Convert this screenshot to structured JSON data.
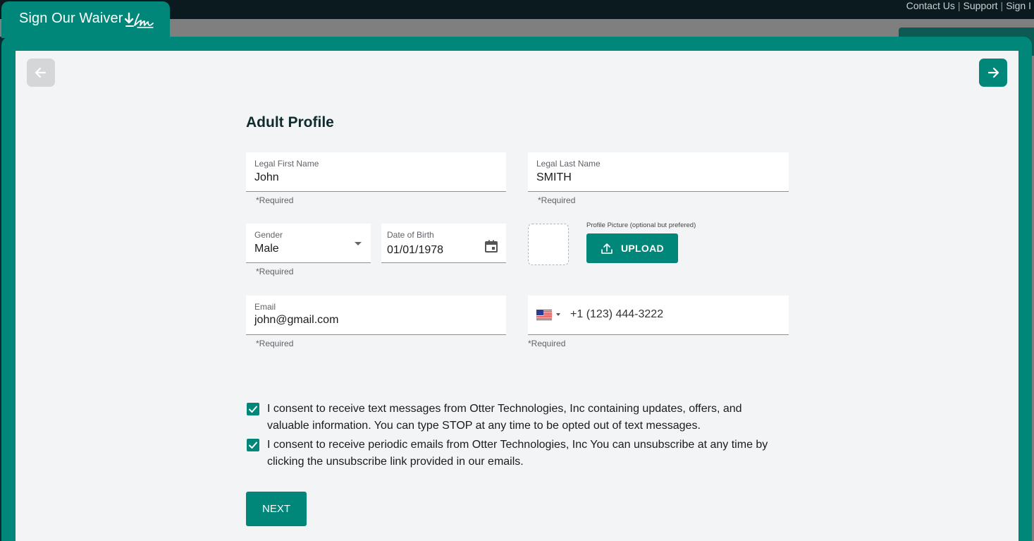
{
  "top_links": [
    "Contact Us",
    "Support",
    "Sign I"
  ],
  "tab": {
    "label": "Sign Our Waiver"
  },
  "form": {
    "title": "Adult Profile",
    "first_name": {
      "label": "Legal First Name",
      "value": "John",
      "helper": "*Required"
    },
    "last_name": {
      "label": "Legal Last Name",
      "value": "SMITH",
      "helper": "*Required"
    },
    "gender": {
      "label": "Gender",
      "value": "Male",
      "helper": "*Required"
    },
    "dob": {
      "label": "Date of Birth",
      "value": "01/01/1978"
    },
    "picture": {
      "label": "Profile Picture (optional but prefered)",
      "upload_label": "UPLOAD"
    },
    "email": {
      "label": "Email",
      "value": "john@gmail.com",
      "helper": "*Required"
    },
    "phone": {
      "value": "+1 (123) 444-3222",
      "helper": "*Required",
      "country_icon": "us-flag-icon"
    },
    "consents": [
      {
        "text": "I consent to receive text messages from Otter Technologies, Inc containing updates, offers, and valuable information. You can type STOP at any time to be opted out of text messages.",
        "checked": true
      },
      {
        "text": "I consent to receive periodic emails from Otter Technologies, Inc You can unsubscribe at any time by clicking the unsubscribe link provided in our emails.",
        "checked": true
      }
    ],
    "next_label": "NEXT"
  },
  "colors": {
    "brand": "#01877a",
    "background": "#f3f4f6",
    "title": "#0f2b2e"
  }
}
